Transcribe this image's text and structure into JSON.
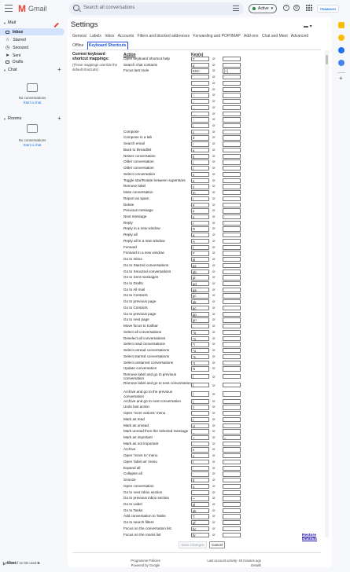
{
  "app": {
    "name": "Gmail"
  },
  "search": {
    "placeholder": "Search all conversations"
  },
  "status": {
    "label": "Active"
  },
  "brand": {
    "label": "TRAWAGO"
  },
  "sidebar": {
    "mail_label": "Mail",
    "items": [
      {
        "label": "Inbox"
      },
      {
        "label": "Starred"
      },
      {
        "label": "Snoozed"
      },
      {
        "label": "Sent"
      },
      {
        "label": "Drafts"
      }
    ],
    "chat": {
      "label": "Chat",
      "empty": "No conversations",
      "link": "Start a chat"
    },
    "rooms": {
      "label": "Rooms",
      "empty": "No conversations",
      "link": "Start a chat"
    },
    "meet_label": "Meet"
  },
  "settings": {
    "title": "Settings",
    "tabs": [
      {
        "label": "General"
      },
      {
        "label": "Labels"
      },
      {
        "label": "Inbox"
      },
      {
        "label": "Accounts"
      },
      {
        "label": "Filters and blocked addresses"
      },
      {
        "label": "Forwarding and POP/IMAP"
      },
      {
        "label": "Add-ons"
      },
      {
        "label": "Chat and Meet"
      },
      {
        "label": "Advanced"
      },
      {
        "label": "Offline"
      },
      {
        "label": "Keyboard Shortcuts"
      }
    ],
    "active_tab": "Keyboard Shortcuts",
    "description_heading": "Current keyboard shortcut mappings:",
    "description_text": "(These mappings override the default shortcuts)",
    "col_action": "Action",
    "col_keys": "Key(s)",
    "or_label": "or",
    "restore_label": "Restore Defaults",
    "save_label": "Save Changes",
    "cancel_label": "Cancel"
  },
  "shortcuts": [
    {
      "action": "Open keyboard shortcut help",
      "key1": "?",
      "key2": ""
    },
    {
      "action": "Search chat contacts",
      "key1": "q",
      "key2": ""
    },
    {
      "action": "Focus last mole",
      "key1": "ESC",
      "key2": "[+]"
    },
    {
      "action": "",
      "key1": "",
      "key2": ""
    },
    {
      "action": "",
      "key1": "",
      "key2": ""
    },
    {
      "action": "",
      "key1": "",
      "key2": ""
    },
    {
      "action": "",
      "key1": "↑",
      "key2": ""
    },
    {
      "action": "",
      "key1": "↓",
      "key2": ""
    },
    {
      "action": "",
      "key1": "←",
      "key2": ""
    },
    {
      "action": "",
      "key1": "→",
      "key2": ""
    },
    {
      "action": "",
      "key1": "↑",
      "key2": ""
    },
    {
      "action": "",
      "key1": "j",
      "key2": ""
    },
    {
      "action": "Compose",
      "key1": "c",
      "key2": ""
    },
    {
      "action": "Compose in a tab",
      "key1": "d",
      "key2": ""
    },
    {
      "action": "Search email",
      "key1": "/",
      "key2": ""
    },
    {
      "action": "Back to threadlist",
      "key1": "u",
      "key2": ""
    },
    {
      "action": "Newer conversation",
      "key1": "k",
      "key2": ""
    },
    {
      "action": "Older conversation",
      "key1": "j",
      "key2": ""
    },
    {
      "action": "Older conversation",
      "key1": "j",
      "key2": ""
    },
    {
      "action": "Select conversation",
      "key1": "x",
      "key2": ""
    },
    {
      "action": "Toggle star/Rotate between superstars",
      "key1": "s",
      "key2": ""
    },
    {
      "action": "Remove label",
      "key1": "y",
      "key2": ""
    },
    {
      "action": "Mute conversation",
      "key1": "m",
      "key2": ""
    },
    {
      "action": "Report as spam",
      "key1": "!",
      "key2": ""
    },
    {
      "action": "Delete",
      "key1": "#",
      "key2": ""
    },
    {
      "action": "Previous message",
      "key1": "p",
      "key2": ""
    },
    {
      "action": "Next message",
      "key1": "n",
      "key2": ""
    },
    {
      "action": "Reply",
      "key1": "r",
      "key2": ""
    },
    {
      "action": "Reply in a new window",
      "key1": "R",
      "key2": ""
    },
    {
      "action": "Reply all",
      "key1": "a",
      "key2": ""
    },
    {
      "action": "Reply all in a new window",
      "key1": "A",
      "key2": ""
    },
    {
      "action": "Forward",
      "key1": "f",
      "key2": ""
    },
    {
      "action": "Forward in a new window",
      "key1": "F",
      "key2": ""
    },
    {
      "action": "Go to Inbox",
      "key1": "gi",
      "key2": ""
    },
    {
      "action": "Go to Starred conversations",
      "key1": "gs",
      "key2": ""
    },
    {
      "action": "Go to Snoozed conversations",
      "key1": "gb",
      "key2": ""
    },
    {
      "action": "Go to Sent messages",
      "key1": "gt",
      "key2": ""
    },
    {
      "action": "Go to Drafts",
      "key1": "gd",
      "key2": ""
    },
    {
      "action": "Go to All mail",
      "key1": "ga",
      "key2": ""
    },
    {
      "action": "Go to Contacts",
      "key1": "gc",
      "key2": ""
    },
    {
      "action": "Go to previous page",
      "key1": "gk",
      "key2": ""
    },
    {
      "action": "Go to Contacts",
      "key1": "gc",
      "key2": ""
    },
    {
      "action": "Go to previous page",
      "key1": "gp",
      "key2": ""
    },
    {
      "action": "Go to next page",
      "key1": "gn",
      "key2": ""
    },
    {
      "action": "Move focus to toolbar",
      "key1": ",",
      "key2": ""
    },
    {
      "action": "Select all conversations",
      "key1": "*a",
      "key2": ""
    },
    {
      "action": "Deselect all conversations",
      "key1": "*n",
      "key2": ""
    },
    {
      "action": "Select read conversations",
      "key1": "*r",
      "key2": ""
    },
    {
      "action": "Select unread conversations",
      "key1": "*u",
      "key2": ""
    },
    {
      "action": "Select starred conversations",
      "key1": "*s",
      "key2": ""
    },
    {
      "action": "Select unstarred conversations",
      "key1": "*t",
      "key2": ""
    },
    {
      "action": "Update conversation",
      "key1": "N",
      "key2": ""
    },
    {
      "action": "Remove label and go to previous conversation",
      "key1": "]",
      "key2": ""
    },
    {
      "action": "Remove label and go to next conversation",
      "key1": "[",
      "key2": ""
    },
    {
      "action": "Archive and go to the previous conversation",
      "key1": "}",
      "key2": ""
    },
    {
      "action": "Archive and go to next conversation",
      "key1": "{",
      "key2": ""
    },
    {
      "action": "Undo last action",
      "key1": "z",
      "key2": ""
    },
    {
      "action": "Open 'more actions' menu",
      "key1": ".",
      "key2": ""
    },
    {
      "action": "Mark as read",
      "key1": "I",
      "key2": ""
    },
    {
      "action": "Mark as unread",
      "key1": "U",
      "key2": ""
    },
    {
      "action": "Mark unread from the selected message",
      "key1": "_",
      "key2": ""
    },
    {
      "action": "Mark as important",
      "key1": "+",
      "key2": "="
    },
    {
      "action": "Mark as not important",
      "key1": "-",
      "key2": ""
    },
    {
      "action": "Archive",
      "key1": "e",
      "key2": ""
    },
    {
      "action": "Open 'move to' menu",
      "key1": "v",
      "key2": ""
    },
    {
      "action": "Open 'label as' menu",
      "key1": "l",
      "key2": ""
    },
    {
      "action": "Expand all",
      "key1": ";",
      "key2": ""
    },
    {
      "action": "Collapse all",
      "key1": ":",
      "key2": ""
    },
    {
      "action": "Snooze",
      "key1": "b",
      "key2": ""
    },
    {
      "action": "Open conversation",
      "key1": "o",
      "key2": ""
    },
    {
      "action": "Go to next inbox section",
      "key1": "`",
      "key2": ""
    },
    {
      "action": "Go to previous inbox section",
      "key1": "~",
      "key2": ""
    },
    {
      "action": "Go to Label",
      "key1": "gl",
      "key2": ""
    },
    {
      "action": "Go to Tasks",
      "key1": "gk",
      "key2": ""
    },
    {
      "action": "Add conversation to Tasks",
      "key1": "T",
      "key2": ""
    },
    {
      "action": "Go to search filters",
      "key1": "gf",
      "key2": ""
    },
    {
      "action": "Focus on the conversation list",
      "key1": "hc",
      "key2": ""
    },
    {
      "action": "Focus on the rooms list",
      "key1": "hr",
      "key2": ""
    }
  ],
  "footer": {
    "storage": "7.05 GB of 15 GB used",
    "policies": "Programme Policies",
    "powered": "Powered by Google",
    "activity": "Last account activity: 40 minutes ago",
    "details": "Details"
  }
}
